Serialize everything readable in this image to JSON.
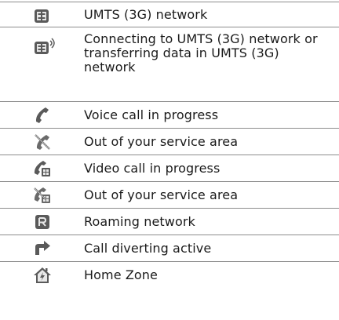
{
  "rows": [
    {
      "icon": "umts-3g-icon",
      "text": "UMTS (3G) network"
    },
    {
      "icon": "umts-3g-connecting-icon",
      "text": "Connecting to UMTS (3G) network or transferring data in UMTS (3G) network"
    },
    {
      "icon": "voice-call-icon",
      "text": "Voice call in progress"
    },
    {
      "icon": "out-of-service-icon",
      "text": "Out of your service area"
    },
    {
      "icon": "video-call-icon",
      "text": "Video call in progress"
    },
    {
      "icon": "video-call-out-of-service-icon",
      "text": "Out of your service area"
    },
    {
      "icon": "roaming-icon",
      "text": "Roaming network"
    },
    {
      "icon": "call-divert-icon",
      "text": "Call diverting active"
    },
    {
      "icon": "home-zone-icon",
      "text": "Home Zone"
    }
  ],
  "colors": {
    "icon_fill": "#5a5a5a",
    "icon_light": "#e8e8e8",
    "rule": "#8c8c8c",
    "text": "#1a1a1a"
  }
}
